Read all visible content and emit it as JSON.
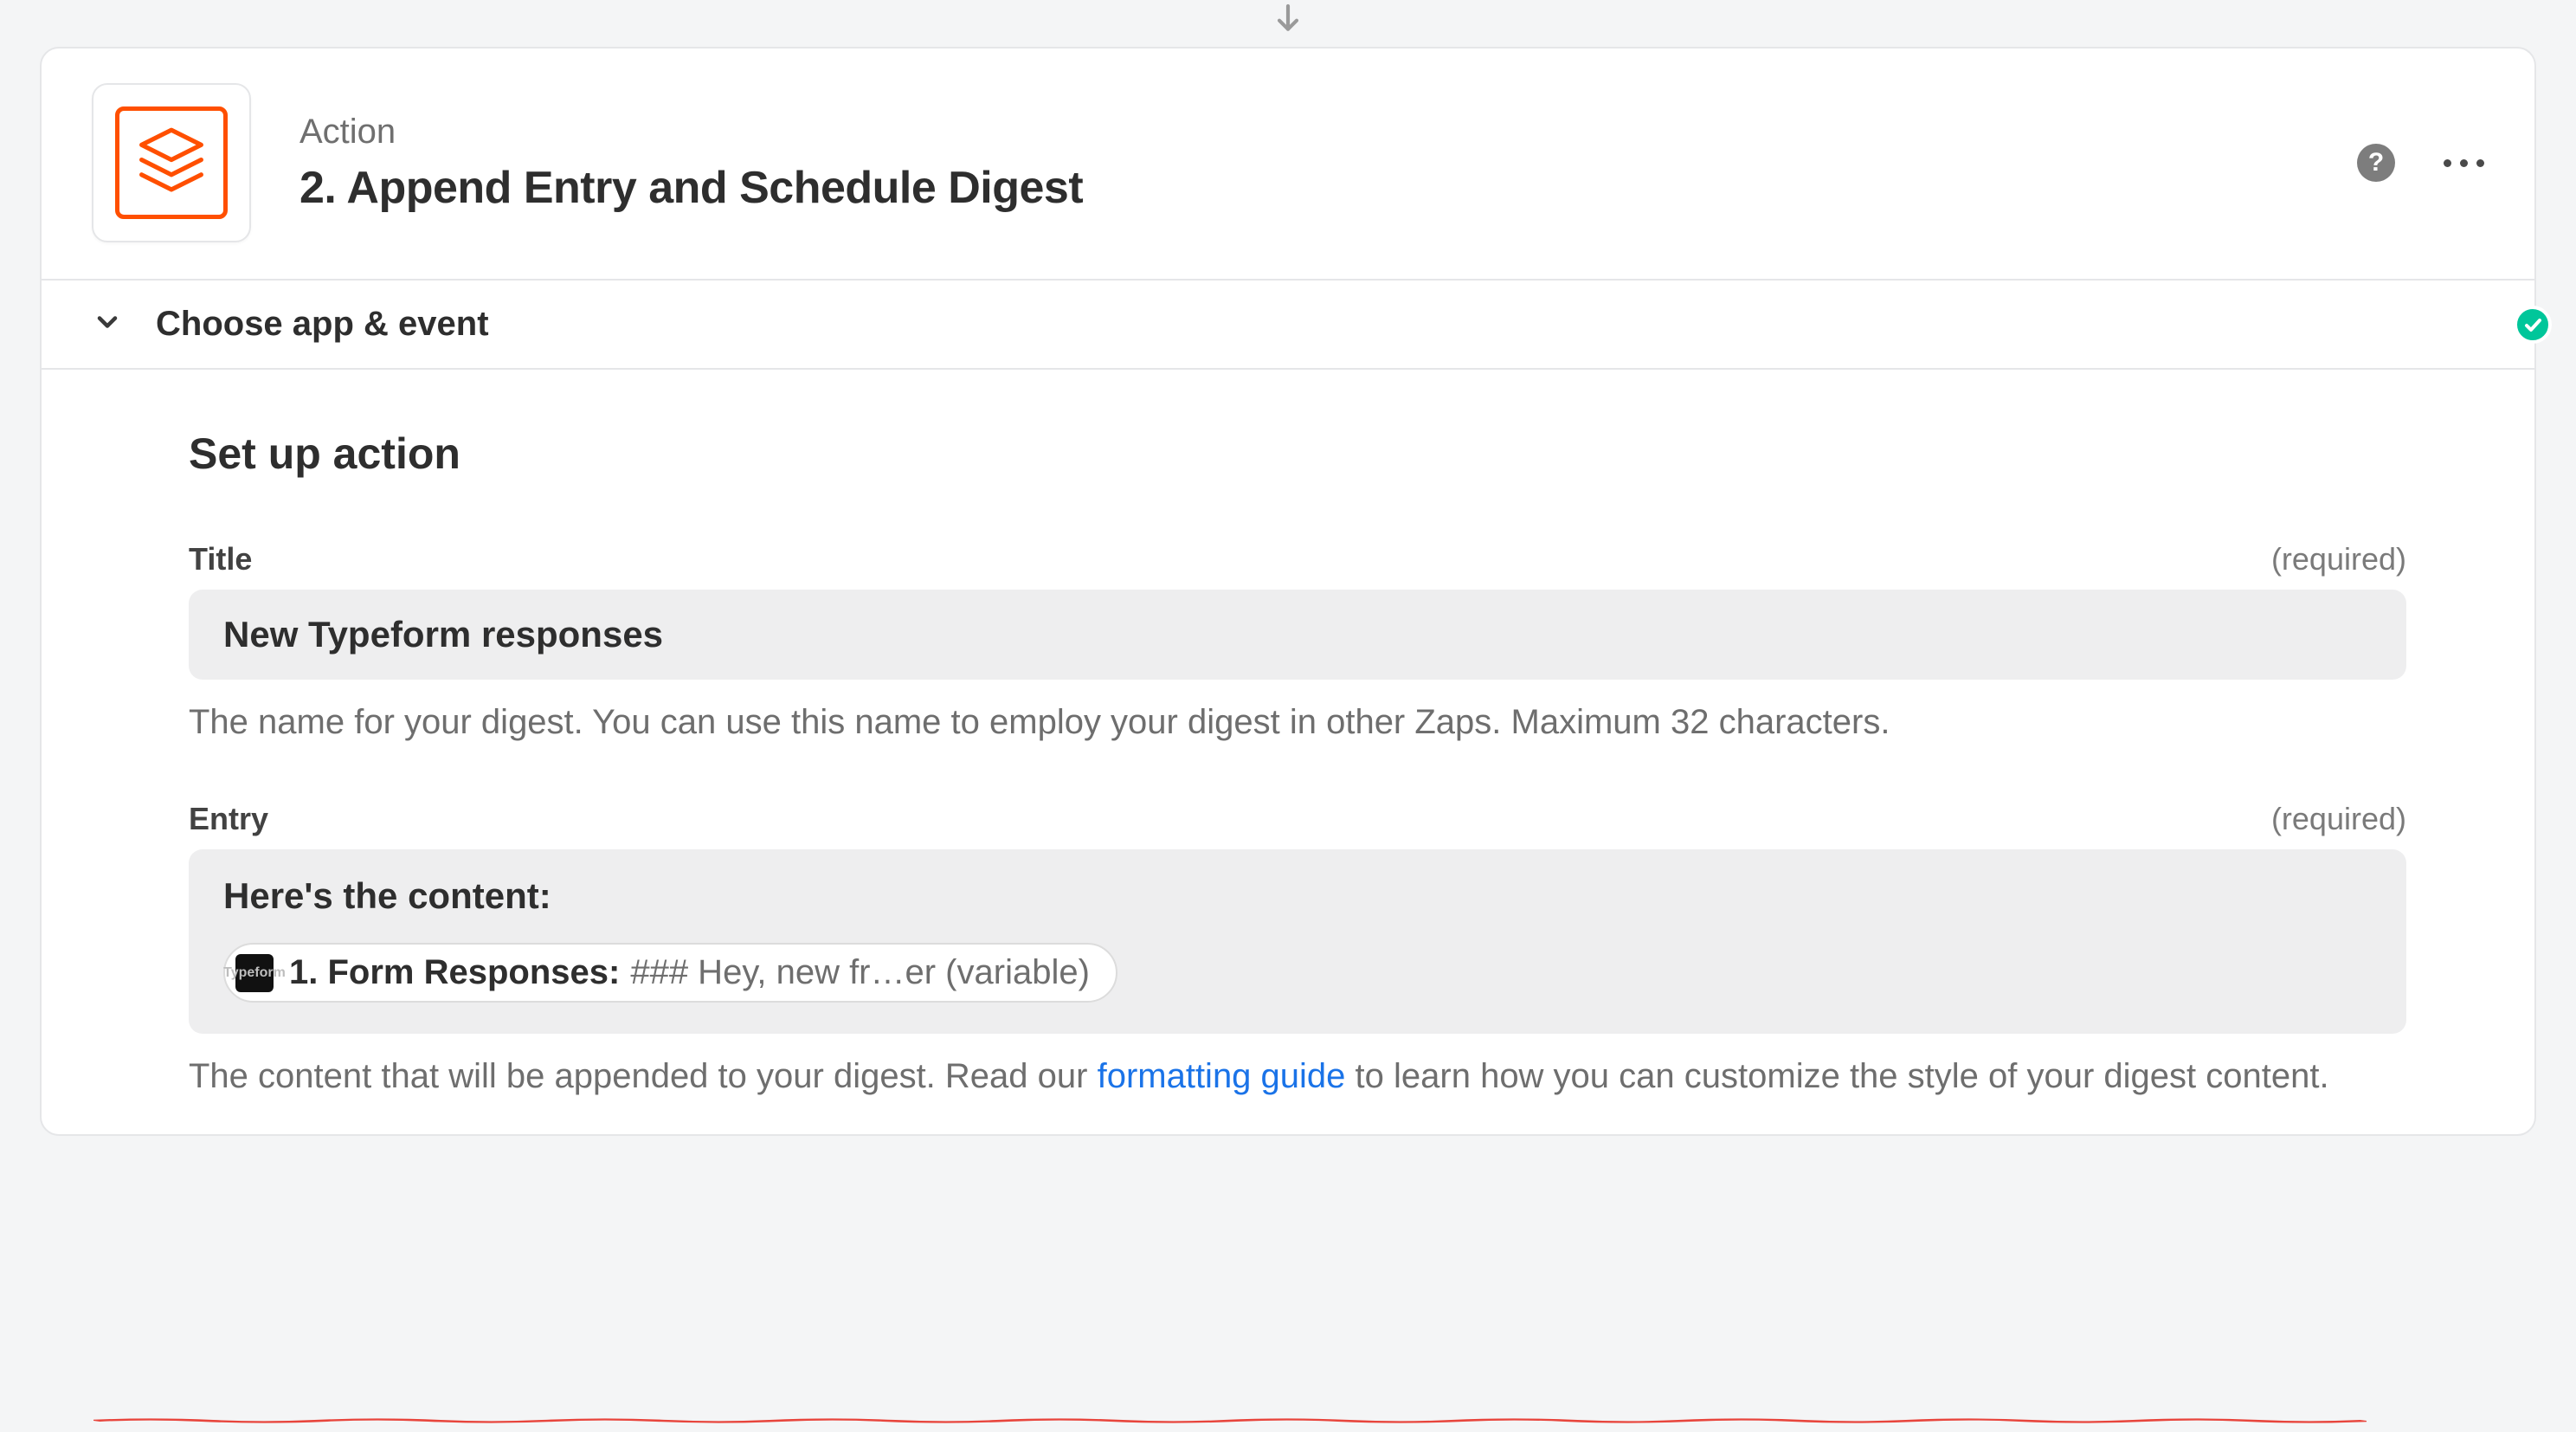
{
  "header": {
    "kicker": "Action",
    "title": "2. Append Entry and Schedule Digest"
  },
  "section": {
    "label": "Choose app & event",
    "status": "complete"
  },
  "setup": {
    "heading": "Set up action",
    "fields": {
      "title": {
        "label": "Title",
        "required_text": "(required)",
        "value": "New Typeform responses",
        "spell_error_word": "Typeform",
        "help": "The name for your digest. You can use this name to employ your digest in other Zaps. Maximum 32 characters."
      },
      "entry": {
        "label": "Entry",
        "required_text": "(required)",
        "lead": "Here's the content:",
        "pill_icon_text": "Typeform",
        "pill_label": "1. Form Responses:",
        "pill_preview": "### Hey, new fr…er (variable)",
        "help_1": "The content that will be appended to your digest. Read our ",
        "help_link_text": "formatting guide",
        "help_2": " to learn how you can customize the style of your digest content."
      }
    }
  }
}
